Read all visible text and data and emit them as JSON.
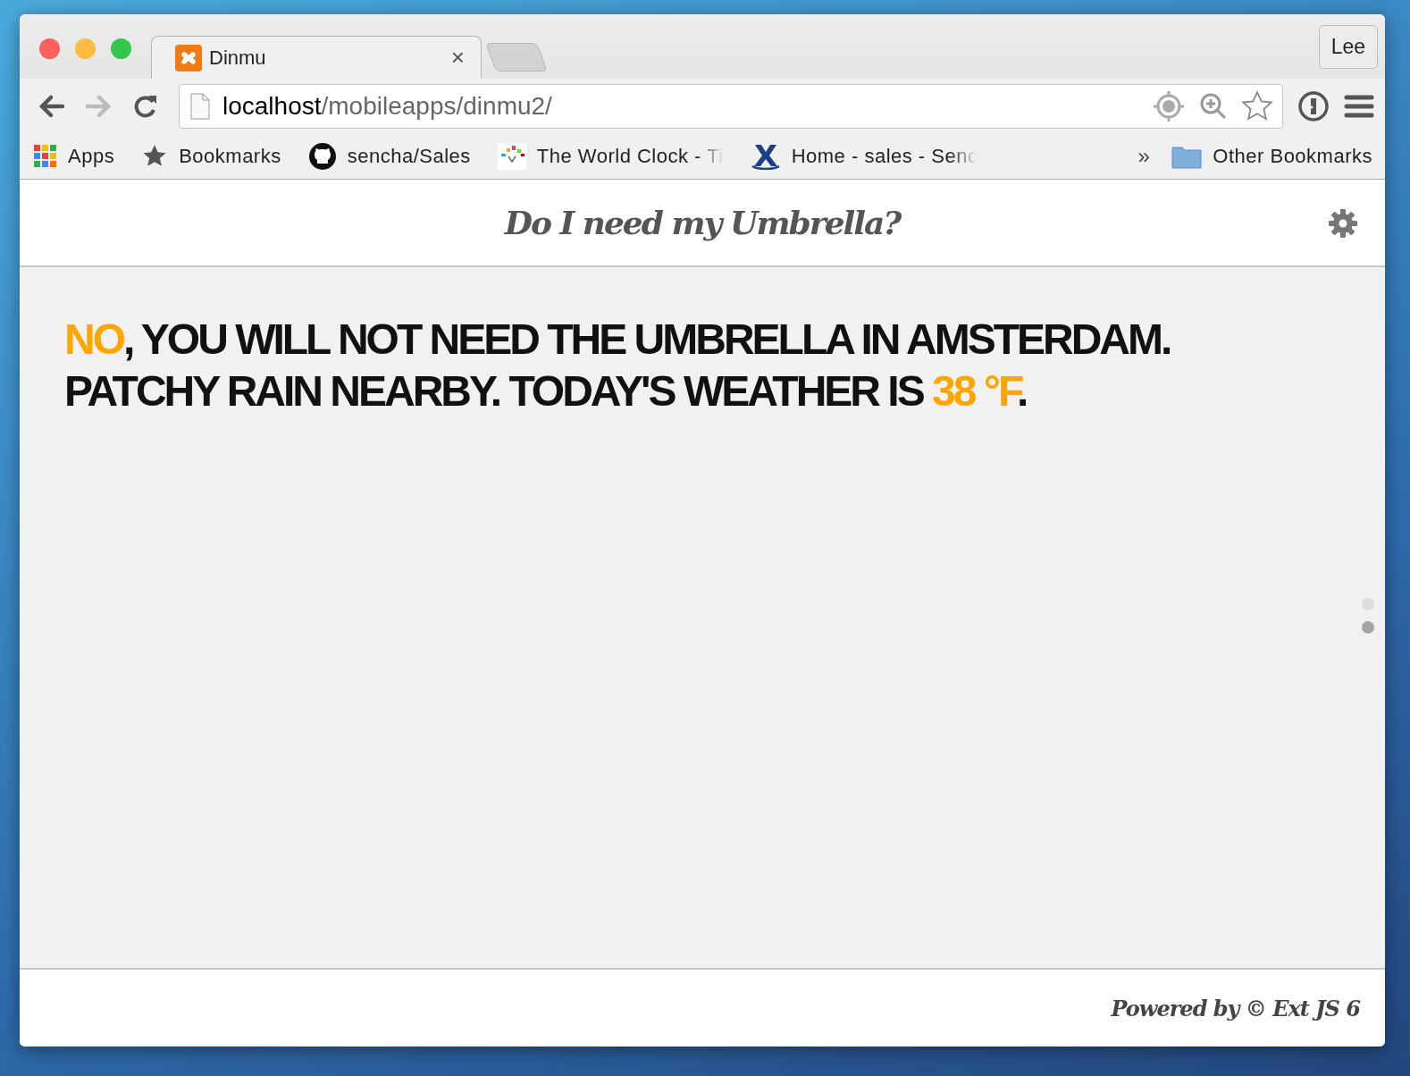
{
  "window": {
    "controls": [
      {
        "color": "#fc605c"
      },
      {
        "color": "#fdbc40"
      },
      {
        "color": "#34c84a"
      }
    ],
    "profile": "Lee"
  },
  "tabs": [
    {
      "title": "Dinmu",
      "close": "×",
      "selected": true
    }
  ],
  "toolbar": {
    "url_host": "localhost",
    "url_path": "/mobileapps/dinmu2/"
  },
  "bookmarks": [
    {
      "label": "Apps",
      "kind": "apps",
      "faded": false
    },
    {
      "label": "Bookmarks",
      "kind": "star",
      "faded": false
    },
    {
      "label": "sencha/Sales",
      "kind": "github",
      "faded": false
    },
    {
      "label": "The World Clock - Ti",
      "kind": "clock",
      "faded": true
    },
    {
      "label": "Home - sales - Senc",
      "kind": "x",
      "faded": true
    }
  ],
  "bookmarks_more": "»",
  "other_bookmarks": "Other Bookmarks",
  "app": {
    "title": "Do I need my Umbrella?",
    "headline": [
      {
        "text": "NO",
        "highlight": true
      },
      {
        "text": ", YOU WILL NOT NEED THE UMBRELLA IN AMSTERDAM. PATCHY RAIN NEARBY. TODAY'S WEATHER IS ",
        "highlight": false
      },
      {
        "text": "38 °F",
        "highlight": true
      },
      {
        "text": ".",
        "highlight": false
      }
    ],
    "pages": [
      {
        "selected": false
      },
      {
        "selected": true
      }
    ],
    "footer": "Powered by © Ext JS 6"
  }
}
